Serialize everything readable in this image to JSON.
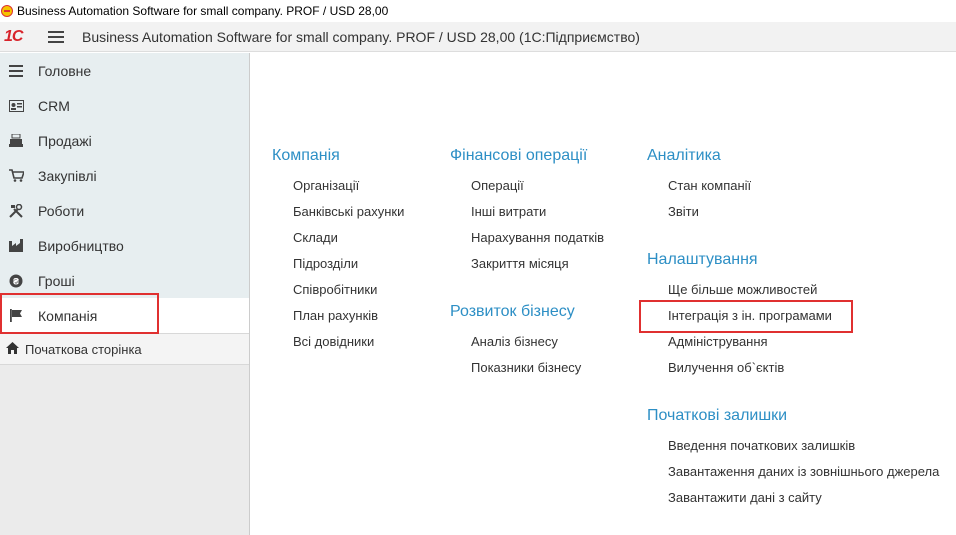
{
  "window": {
    "title": "Business Automation Software for small company. PROF / USD 28,00"
  },
  "appbar": {
    "logo_text": "1С",
    "title": "Business Automation Software for small company. PROF / USD 28,00  (1С:Підприємство)"
  },
  "sidebar": {
    "items": [
      {
        "label": "Головне",
        "icon": "menu-lines-icon"
      },
      {
        "label": "CRM",
        "icon": "contact-card-icon"
      },
      {
        "label": "Продажі",
        "icon": "cash-register-icon"
      },
      {
        "label": "Закупівлі",
        "icon": "shopping-cart-icon"
      },
      {
        "label": "Роботи",
        "icon": "tools-icon"
      },
      {
        "label": "Виробництво",
        "icon": "factory-icon"
      },
      {
        "label": "Гроші",
        "icon": "coin-icon"
      },
      {
        "label": "Компанія",
        "icon": "flag-icon",
        "active": true
      }
    ],
    "home_label": "Початкова сторінка"
  },
  "columns": {
    "company": {
      "title": "Компанія",
      "links": [
        "Організації",
        "Банківські рахунки",
        "Склади",
        "Підрозділи",
        "Співробітники",
        "План рахунків",
        "Всі довідники"
      ]
    },
    "finance": {
      "title": "Фінансові операції",
      "links": [
        "Операції",
        "Інші витрати",
        "Нарахування податків",
        "Закриття місяця"
      ]
    },
    "business": {
      "title": "Розвиток бізнесу",
      "links": [
        "Аналіз бізнесу",
        "Показники бізнесу"
      ]
    },
    "analytics": {
      "title": "Аналітика",
      "links": [
        "Стан компанії",
        "Звіти"
      ]
    },
    "settings": {
      "title": "Налаштування",
      "links": [
        "Ще більше можливостей",
        "Інтеграція з ін. програмами",
        "Адміністрування",
        "Вилучення об`єктів"
      ]
    },
    "balances": {
      "title": "Початкові залишки",
      "links": [
        "Введення початкових залишків",
        "Завантаження даних із зовнішнього джерела",
        "Завантажити дані з сайту"
      ]
    }
  },
  "colors": {
    "accent": "#2d8fc5",
    "highlight": "#e03030",
    "brand": "#d8232a"
  }
}
